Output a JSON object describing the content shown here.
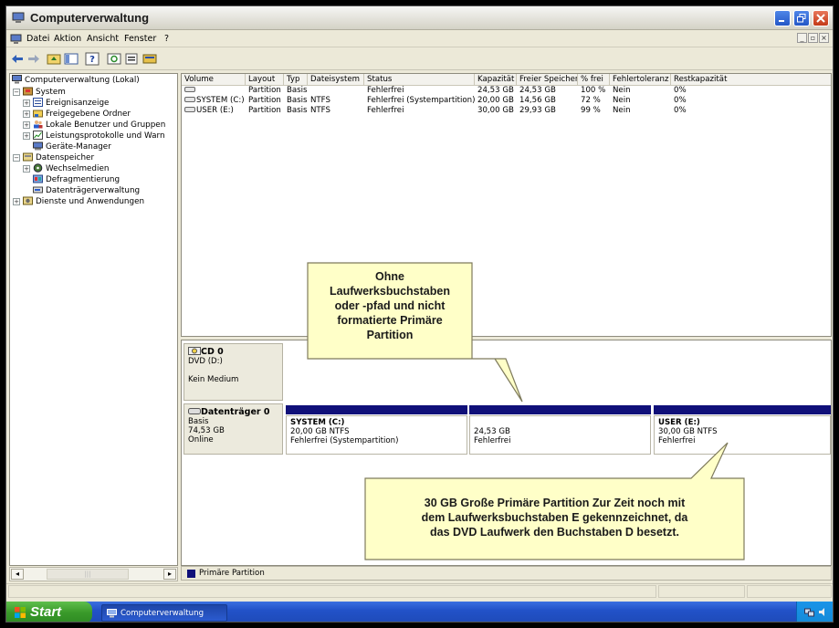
{
  "window": {
    "title": "Computerverwaltung"
  },
  "menu": {
    "items": [
      "Datei",
      "Aktion",
      "Ansicht",
      "Fenster",
      "?"
    ]
  },
  "tree": {
    "root": "Computerverwaltung (Lokal)",
    "system": "System",
    "ereignis": "Ereignisanzeige",
    "freigegeben": "Freigegebene Ordner",
    "lokale": "Lokale Benutzer und Gruppen",
    "leistung": "Leistungsprotokolle und Warn",
    "geraete": "Geräte-Manager",
    "datenspeicher": "Datenspeicher",
    "wechsel": "Wechselmedien",
    "defrag": "Defragmentierung",
    "datentraeger": "Datenträgerverwaltung",
    "dienste": "Dienste und Anwendungen"
  },
  "volumes": {
    "columns": [
      "Volume",
      "Layout",
      "Typ",
      "Dateisystem",
      "Status",
      "Kapazität",
      "Freier Speicher",
      "% frei",
      "Fehlertoleranz",
      "Restkapazität"
    ],
    "rows": [
      [
        "",
        "Partition",
        "Basis",
        "",
        "Fehlerfrei",
        "24,53 GB",
        "24,53 GB",
        "100 %",
        "Nein",
        "0%"
      ],
      [
        "SYSTEM (C:)",
        "Partition",
        "Basis",
        "NTFS",
        "Fehlerfrei (Systempartition)",
        "20,00 GB",
        "14,56 GB",
        "72 %",
        "Nein",
        "0%"
      ],
      [
        "USER (E:)",
        "Partition",
        "Basis",
        "NTFS",
        "Fehlerfrei",
        "30,00 GB",
        "29,93 GB",
        "99 %",
        "Nein",
        "0%"
      ]
    ]
  },
  "disks": {
    "cd": {
      "name": "CD 0",
      "type": "DVD (D:)",
      "medium": "Kein Medium"
    },
    "disk0": {
      "name": "Datenträger 0",
      "type": "Basis",
      "size": "74,53 GB",
      "state": "Online",
      "partitions": [
        {
          "name": "SYSTEM  (C:)",
          "size": "20,00 GB NTFS",
          "status": "Fehlerfrei (Systempartition)"
        },
        {
          "name": "",
          "size": "24,53 GB",
          "status": "Fehlerfrei"
        },
        {
          "name": "USER  (E:)",
          "size": "30,00 GB NTFS",
          "status": "Fehlerfrei"
        }
      ]
    }
  },
  "legend": {
    "label": "Primäre Partition",
    "color": "#101079"
  },
  "callouts": {
    "top": [
      "Ohne",
      "Laufwerksbuchstaben",
      "oder -pfad und nicht",
      "formatierte Primäre",
      "Partition"
    ],
    "bottom": [
      "30 GB Große Primäre Partition  Zur Zeit noch mit",
      "dem Laufwerksbuchstaben E gekennzeichnet, da",
      "das DVD Laufwerk den Buchstaben D besetzt."
    ],
    "fill": "#ffffc8"
  },
  "taskbar": {
    "start": "Start",
    "task": "Computerverwaltung"
  }
}
